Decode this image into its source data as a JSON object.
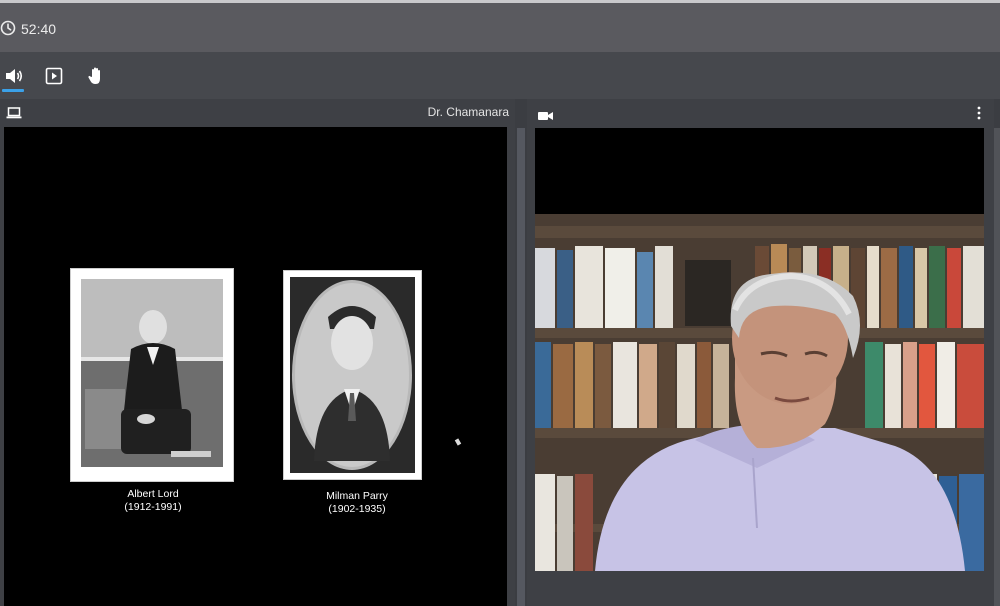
{
  "session": {
    "elapsed_time": "52:40",
    "clock_icon": "clock-icon"
  },
  "toolbar": {
    "items": [
      {
        "name": "speaker-icon",
        "active": true
      },
      {
        "name": "play-icon",
        "active": false
      },
      {
        "name": "raise-hand-icon",
        "active": false
      }
    ]
  },
  "screen_share": {
    "icon": "laptop-icon",
    "presenter": "Dr. Chamanara",
    "slide": {
      "photos": [
        {
          "name": "Albert Lord",
          "years": "(1912-1991)"
        },
        {
          "name": "Milman Parry",
          "years": "(1902-1935)"
        }
      ]
    }
  },
  "camera": {
    "icon": "video-camera-icon",
    "menu_icon": "more-vertical-icon"
  },
  "colors": {
    "top_bar": "#5a5a5f",
    "toolbar": "#46484d",
    "accent": "#3ba1e8",
    "panel": "#3e4045"
  }
}
